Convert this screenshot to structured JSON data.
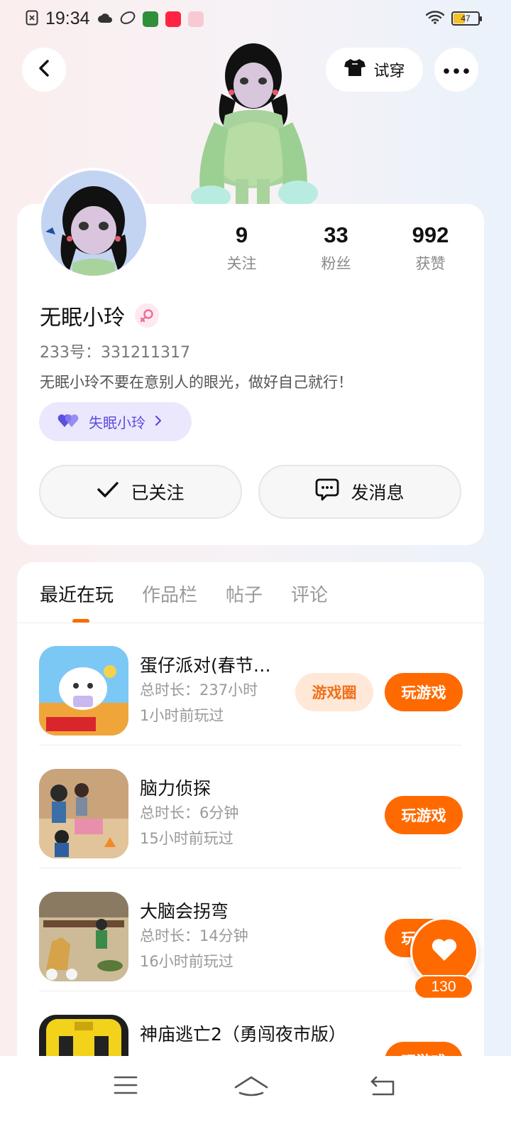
{
  "status_bar": {
    "time": "19:34",
    "battery": "47",
    "battery_level": 0.47
  },
  "header": {
    "tryon_label": "试穿"
  },
  "profile": {
    "stats": [
      {
        "value": "9",
        "label": "关注"
      },
      {
        "value": "33",
        "label": "粉丝"
      },
      {
        "value": "992",
        "label": "获赞"
      }
    ],
    "name": "无眠小玲",
    "user_id": "233号：331211317",
    "bio": "无眠小玲不要在意别人的眼光，做好自己就行！",
    "tag_label": "失眠小玲",
    "follow_label": "已关注",
    "message_label": "发消息"
  },
  "tabs": [
    {
      "label": "最近在玩",
      "active": true
    },
    {
      "label": "作品栏",
      "active": false
    },
    {
      "label": "帖子",
      "active": false
    },
    {
      "label": "评论",
      "active": false
    }
  ],
  "games": [
    {
      "title": "蛋仔派对(春节…",
      "duration": "总时长：237小时",
      "last_played": "1小时前玩过",
      "circle_label": "游戏圈",
      "play_label": "玩游戏"
    },
    {
      "title": "脑力侦探",
      "duration": "总时长：6分钟",
      "last_played": "15小时前玩过",
      "play_label": "玩游戏"
    },
    {
      "title": "大脑会拐弯",
      "duration": "总时长：14分钟",
      "last_played": "16小时前玩过",
      "play_label": "玩游戏"
    },
    {
      "title": "神庙逃亡2（勇闯夜市版）",
      "duration": "",
      "last_played": "",
      "play_label": "玩游戏"
    }
  ],
  "fab": {
    "count": "130"
  },
  "colors": {
    "accent": "#ff6a00",
    "tag_bg": "#ebe8fd",
    "tag_text": "#5a4ce0"
  }
}
